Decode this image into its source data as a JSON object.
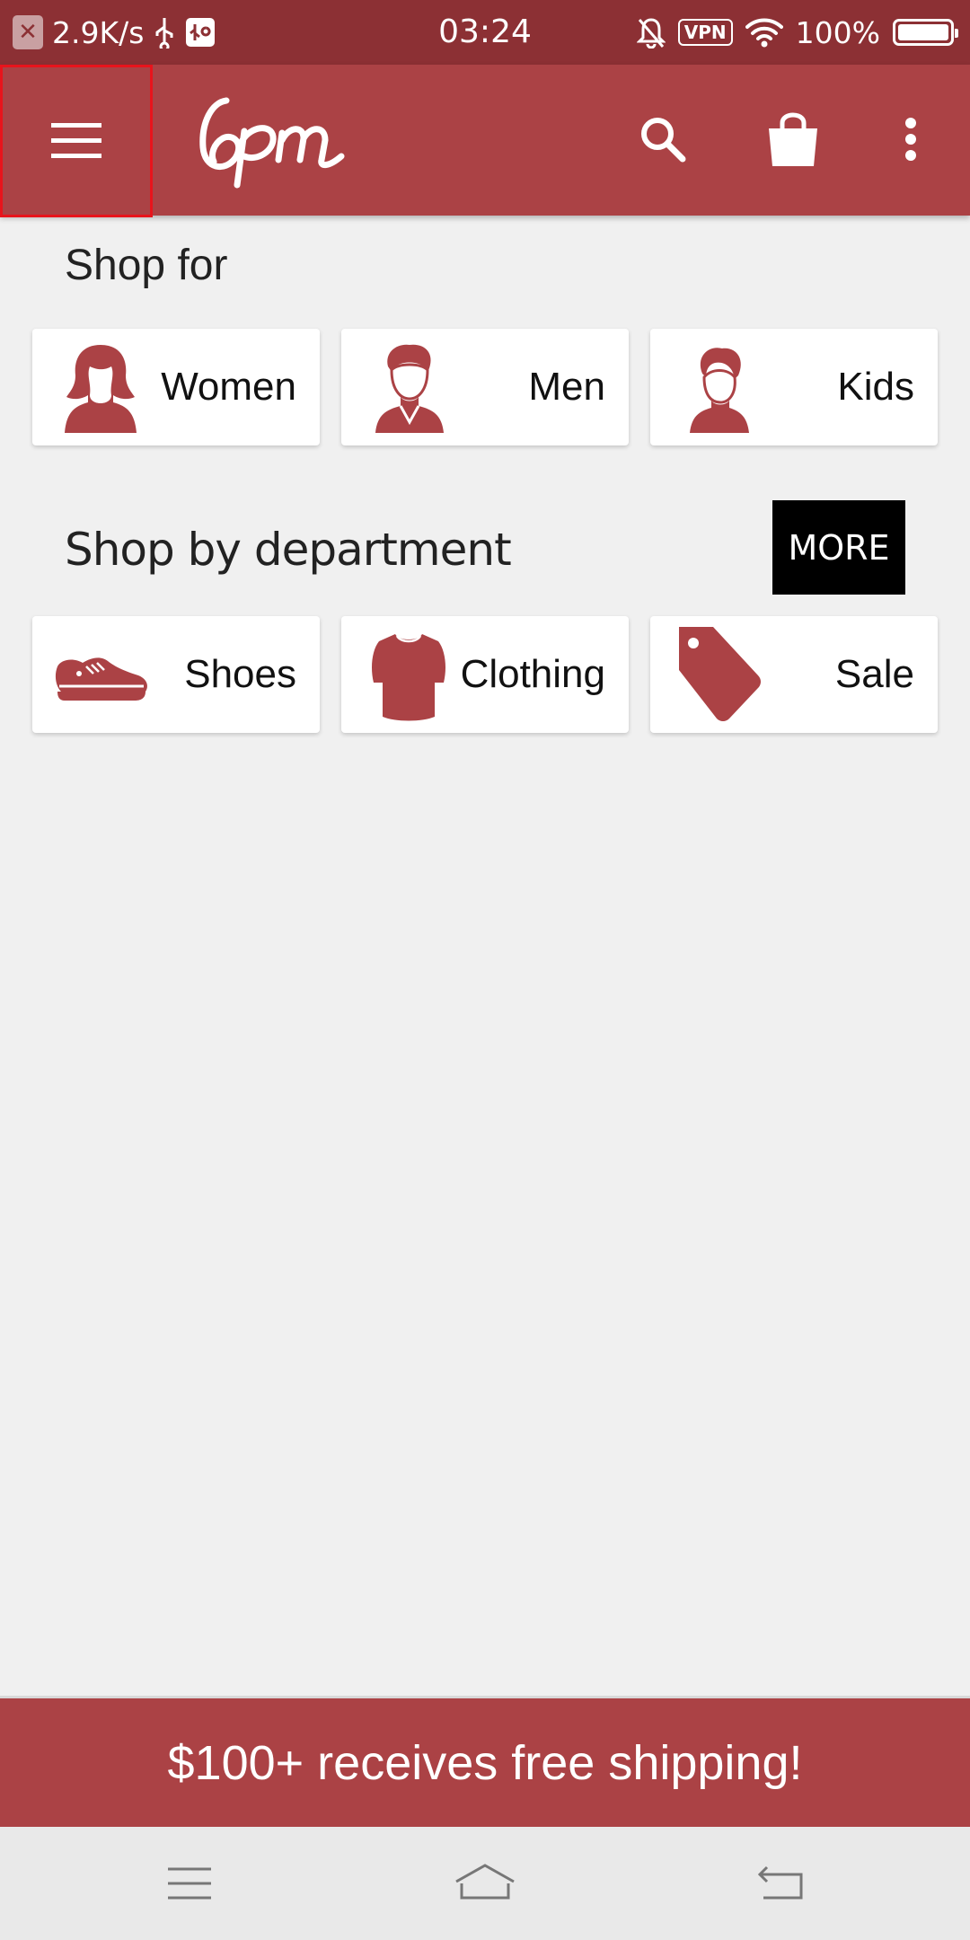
{
  "status_bar": {
    "network_speed": "2.9K/s",
    "time": "03:24",
    "vpn_label": "VPN",
    "battery": "100%"
  },
  "app_bar": {
    "menu_icon": "hamburger-menu-icon",
    "logo_text": "6pm",
    "search_icon": "search-icon",
    "cart_icon": "shopping-bag-icon",
    "overflow_icon": "more-vert-icon",
    "accent_color": "#ab4245"
  },
  "shop_for": {
    "title": "Shop for",
    "items": [
      {
        "label": "Women",
        "icon": "woman-icon"
      },
      {
        "label": "Men",
        "icon": "man-icon"
      },
      {
        "label": "Kids",
        "icon": "kid-icon"
      }
    ]
  },
  "departments": {
    "title": "Shop by department",
    "more_label": "MORE",
    "items": [
      {
        "label": "Shoes",
        "icon": "sneaker-icon"
      },
      {
        "label": "Clothing",
        "icon": "tshirt-icon"
      },
      {
        "label": "Sale",
        "icon": "price-tag-icon"
      }
    ]
  },
  "banner": {
    "text": "$100+ receives free shipping!"
  },
  "nav_bar": {
    "recents_icon": "recents-icon",
    "home_icon": "home-icon",
    "back_icon": "back-icon"
  }
}
